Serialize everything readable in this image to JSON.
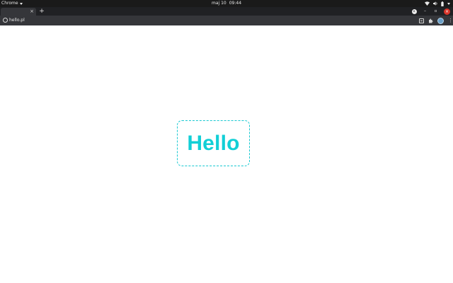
{
  "system_bar": {
    "app_name": "Chrome",
    "date": "maj 10",
    "time": "09:44"
  },
  "browser": {
    "tab": {
      "close_glyph": "×"
    },
    "new_tab_glyph": "+",
    "url": "hello.pl",
    "window_controls": {
      "minimize_glyph": "–",
      "maximize_glyph": "▫",
      "close_glyph": "×"
    }
  },
  "page": {
    "heading": "Hello"
  },
  "colors": {
    "hello_accent": "#12cfd6",
    "close_button": "#d9352a"
  },
  "icons": [
    "wifi-icon",
    "volume-icon",
    "battery-icon",
    "site-info-icon",
    "reader-mode-icon",
    "extensions-icon",
    "profile-avatar",
    "menu-icon"
  ]
}
